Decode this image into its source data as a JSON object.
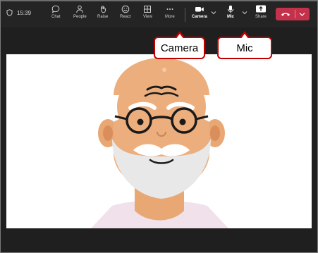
{
  "toolbar": {
    "timer": "15:39",
    "buttons": {
      "chat": "Chat",
      "people": "People",
      "raise": "Raise",
      "react": "React",
      "view": "View",
      "more": "More",
      "camera": "Camera",
      "mic": "Mic",
      "share": "Share"
    }
  },
  "callouts": {
    "camera": "Camera",
    "mic": "Mic"
  },
  "colors": {
    "toolbar_bg": "#242424",
    "end_call": "#c4314b",
    "callout_border": "#c00000"
  }
}
